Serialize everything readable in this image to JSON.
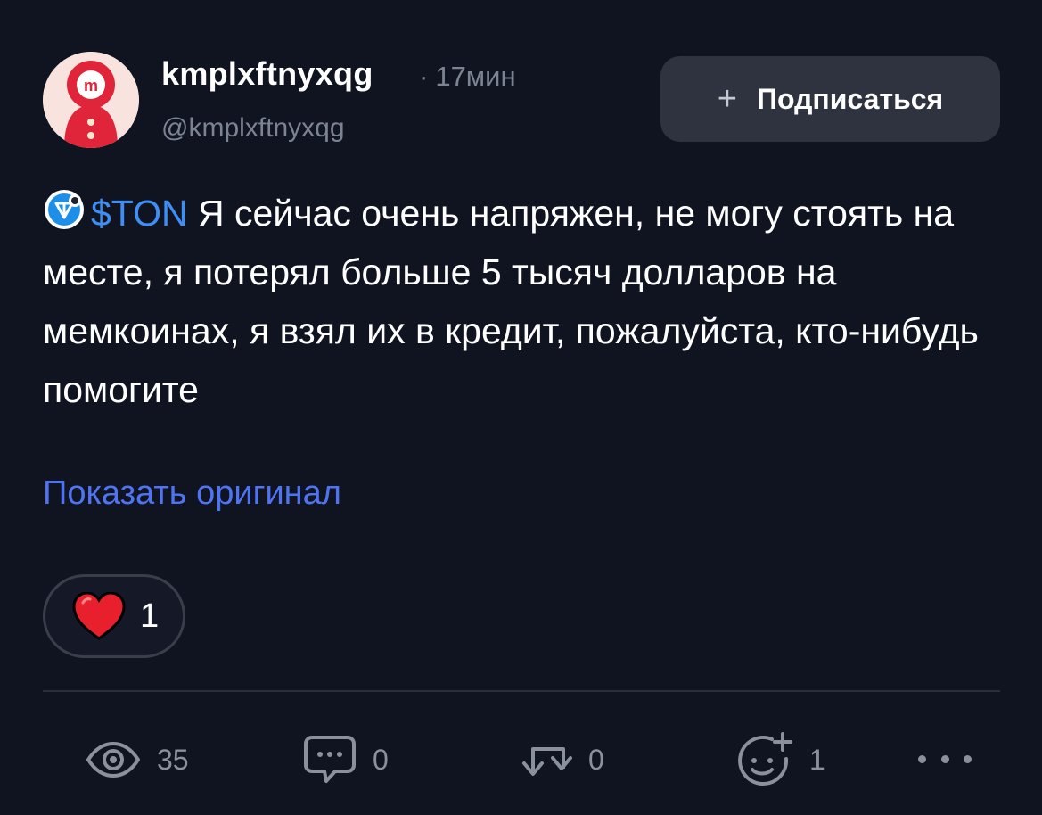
{
  "post": {
    "author": {
      "username": "kmplxftnyxqg",
      "handle": "@kmplxftnyxqg",
      "avatar_icon": "red-mascot-avatar"
    },
    "time_separator": "·",
    "time": "17мин",
    "subscribe": {
      "plus": "+",
      "label": "Подписаться"
    },
    "tag_icon": "ton-logo-icon",
    "tag": "$TON",
    "text": "Я сейчас очень напряжен, не могу стоять на месте, я потерял больше 5 тысяч долларов на мемкоинах, я взял их в кредит, пожалуйста, кто-нибудь помогите",
    "show_original": "Показать оригинал",
    "reaction": {
      "icon": "heart-icon",
      "count": "1"
    }
  },
  "stats": {
    "views": "35",
    "comments": "0",
    "reposts": "0",
    "reactions": "1"
  },
  "colors": {
    "background": "#101320",
    "accent_link": "#4f74f3",
    "ton_blue": "#3d8ef5",
    "heart": "#e8202e",
    "muted": "#7c8392"
  }
}
